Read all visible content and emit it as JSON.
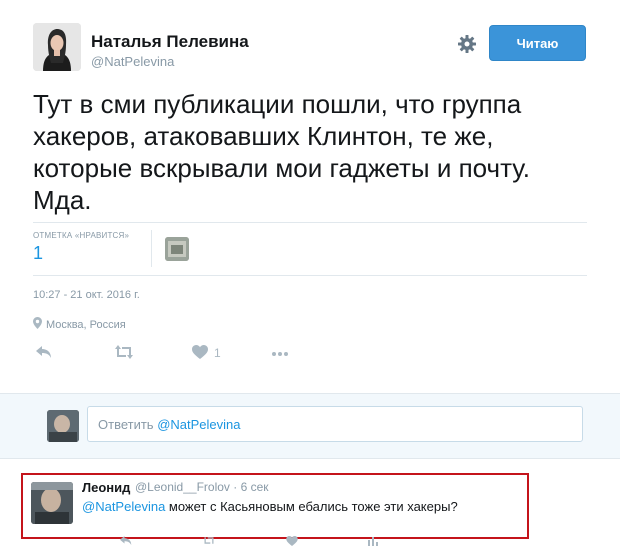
{
  "tweet": {
    "author_name": "Наталья Пелевина",
    "author_handle": "@NatPelevina",
    "follow_label": "Читаю",
    "text": "Тут в сми публикации пошли, что группа хакеров, атаковавших Клинтон, те же, которые вскрывали мои гаджеты и почту. Мда.",
    "likes_label": "ОТМЕТКА «НРАВИТСЯ»",
    "likes_count": "1",
    "timestamp": "10:27 - 21 окт. 2016 г.",
    "location": "Москва, Россия",
    "actions": [
      {
        "icon": "reply-icon",
        "count": ""
      },
      {
        "icon": "retweet-icon",
        "count": ""
      },
      {
        "icon": "heart-icon",
        "count": "1"
      },
      {
        "icon": "more-icon",
        "count": ""
      }
    ]
  },
  "reply_composer": {
    "prefix": "Ответить ",
    "mention": "@NatPelevina"
  },
  "reply": {
    "author_name": "Леонид",
    "meta": "@Leonid__Frolov · 6 сек",
    "mention": "@NatPelevina",
    "text": " может с Касьяновым ебались тоже эти хакеры?"
  },
  "colors": {
    "accent": "#1b95e0",
    "follow_button": "#3b94d9",
    "highlight_border": "#c4141b",
    "muted": "#8899a6"
  }
}
